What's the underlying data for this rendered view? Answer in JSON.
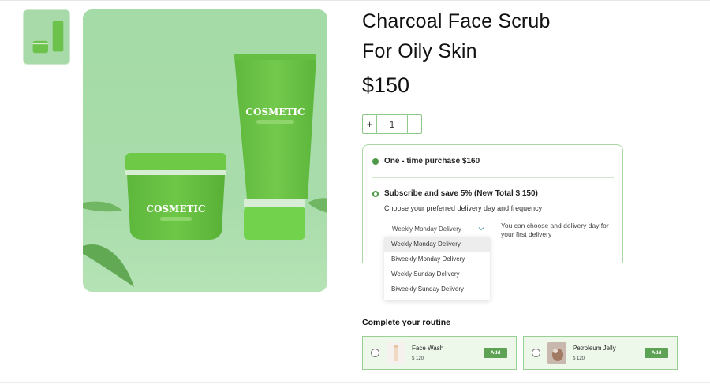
{
  "product": {
    "title_line1": "Charcoal Face Scrub",
    "title_line2": "For Oily Skin",
    "price": "$150",
    "image_brand": "COSMETIC"
  },
  "quantity": {
    "plus_label": "+",
    "value": "1",
    "minus_label": "-"
  },
  "purchase_options": {
    "one_time": "One - time purchase $160",
    "subscribe": "Subscribe and save 5% (New Total $ 150)",
    "subscribe_hint": "Choose your preferred delivery day and frequency",
    "selected_frequency": "Weekly Monday Delivery",
    "frequency_note": "You can choose and delivery day for your first delivery",
    "frequency_options": [
      "Weekly Monday Delivery",
      "Biweekly Monday Delivery",
      "Weekly Sunday Delivery",
      "Biweekly  Sunday Delivery"
    ]
  },
  "routine": {
    "title": "Complete your routine",
    "items": [
      {
        "name": "Face Wash",
        "price": "$ 120",
        "add_label": "Add"
      },
      {
        "name": "Petroleum Jelly",
        "price": "$ 120",
        "add_label": "Add"
      }
    ]
  },
  "colors": {
    "accent": "#5da255",
    "image_background": "#a8dcaa",
    "border": "#a9d7a3"
  }
}
